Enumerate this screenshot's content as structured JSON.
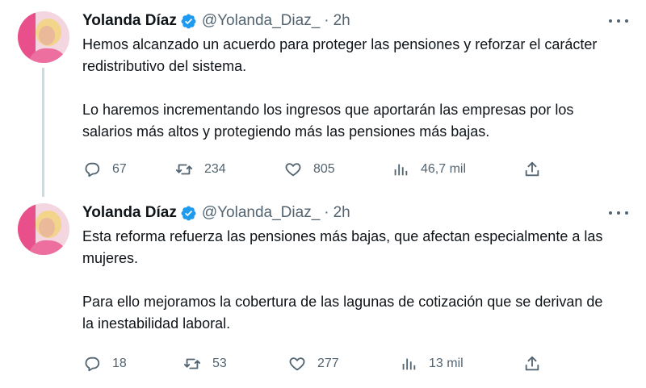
{
  "tweets": [
    {
      "author": {
        "name": "Yolanda Díaz",
        "handle": "@Yolanda_Diaz_",
        "verified": true
      },
      "time": "2h",
      "separator": "·",
      "paragraphs": [
        "Hemos alcanzado un acuerdo para proteger las pensiones y reforzar el carácter redistributivo del sistema.",
        "Lo haremos incrementando los ingresos que aportarán las empresas por los salarios más altos y protegiendo más las pensiones más bajas."
      ],
      "stats": {
        "replies": "67",
        "retweets": "234",
        "likes": "805",
        "views": "46,7 mil"
      },
      "thread_continues": true
    },
    {
      "author": {
        "name": "Yolanda Díaz",
        "handle": "@Yolanda_Diaz_",
        "verified": true
      },
      "time": "2h",
      "separator": "·",
      "paragraphs": [
        "Esta reforma refuerza las pensiones más bajas, que afectan especialmente a las mujeres.",
        "Para ello mejoramos la cobertura de las lagunas de cotización que se derivan de la inestabilidad laboral."
      ],
      "stats": {
        "replies": "18",
        "retweets": "53",
        "likes": "277",
        "views": "13 mil"
      },
      "thread_continues": false
    }
  ],
  "icons": {
    "reply": "reply-icon",
    "retweet": "retweet-icon",
    "like": "heart-icon",
    "views": "views-icon",
    "share": "share-icon",
    "more": "more-icon",
    "verified": "verified-icon"
  },
  "colors": {
    "verified": "#1d9bf0",
    "secondary_text": "#536471",
    "primary_text": "#0f1419",
    "thread_line": "#cfd9de"
  }
}
